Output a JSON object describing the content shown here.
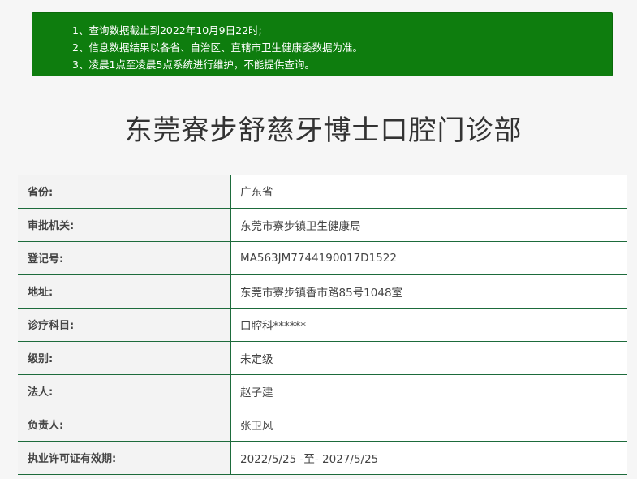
{
  "notice": {
    "lines": [
      "1、查询数据截止到2022年10月9日22时;",
      "2、信息数据结果以各省、自治区、直辖市卫生健康委数据为准。",
      "3、凌晨1点至凌晨5点系统进行维护，不能提供查询。"
    ]
  },
  "page": {
    "title": "东莞寮步舒慈牙博士口腔门诊部"
  },
  "colors": {
    "notice_bg": "#0e7d0e",
    "row_border": "#1d6b3b"
  },
  "records": [
    {
      "label": "省份:",
      "value": "广东省"
    },
    {
      "label": "审批机关:",
      "value": "东莞市寮步镇卫生健康局"
    },
    {
      "label": "登记号:",
      "value": "MA563JM7744190017D1522"
    },
    {
      "label": "地址:",
      "value": "东莞市寮步镇香市路85号1048室"
    },
    {
      "label": "诊疗科目:",
      "value": "口腔科******"
    },
    {
      "label": "级别:",
      "value": "未定级"
    },
    {
      "label": "法人:",
      "value": "赵子建"
    },
    {
      "label": "负责人:",
      "value": "张卫风"
    },
    {
      "label": "执业许可证有效期:",
      "value": "2022/5/25 -至- 2027/5/25"
    }
  ]
}
